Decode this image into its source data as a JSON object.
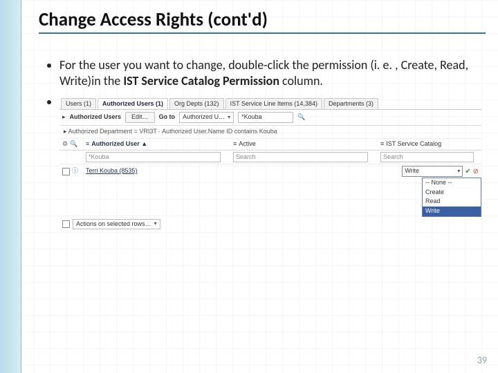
{
  "slide": {
    "title": "Change Access Rights (cont'd)",
    "bullet1_pre": "For the user you want to change, double-click the permission (i. e. , Create, Read, Write)in the ",
    "bullet1_bold": "IST Service Catalog Permission",
    "bullet1_post": " column.",
    "page_number": "39"
  },
  "shot": {
    "tabs": [
      {
        "label": "Users (1)",
        "active": false
      },
      {
        "label": "Authorized Users (1)",
        "active": true
      },
      {
        "label": "Org Depts (132)",
        "active": false
      },
      {
        "label": "IST Service Line Items (14,384)",
        "active": false
      },
      {
        "label": "Departments (3)",
        "active": false
      }
    ],
    "toolbar": {
      "section": "Authorized Users",
      "edit": "Edit…",
      "goto_label": "Go to",
      "goto_value": "Authorized U…",
      "ksearch": "*Kouba"
    },
    "desc": "Authorized Department = VRI3T · Authorized User.Name ID contains Kouba",
    "columns": {
      "user": "Authorized User ▲",
      "active": "Active",
      "perm": "IST Service Catalog"
    },
    "search_placeholders": {
      "user": "*Kouba",
      "active": "Search",
      "perm": "Search"
    },
    "row": {
      "name": "Terri Kouba (8535)",
      "active": ""
    },
    "perm_input": "Write",
    "perm_options": [
      "-- None --",
      "Create",
      "Read",
      "Write"
    ],
    "actions_label": "Actions on selected rows…"
  }
}
